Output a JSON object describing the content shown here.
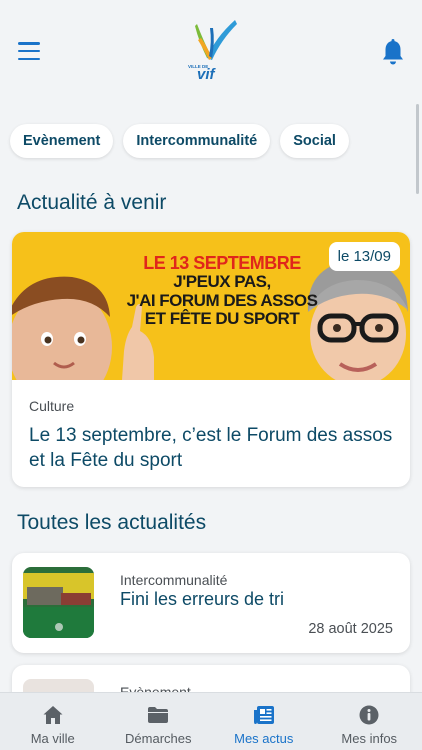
{
  "header": {
    "logo_line1": "VILLE DE",
    "logo_line2": "vif",
    "menu_icon": "hamburger-menu-icon",
    "bell_icon": "bell-icon"
  },
  "categories": [
    {
      "label": "Evènement"
    },
    {
      "label": "Intercommunalité"
    },
    {
      "label": "Social"
    }
  ],
  "upcoming": {
    "section_title": "Actualité à venir",
    "card": {
      "banner_lines": [
        "LE 13 SEPTEMBRE",
        "J'PEUX PAS,",
        "J'AI FORUM DES ASSOS",
        "ET FÊTE DU SPORT"
      ],
      "date_badge": "le 13/09",
      "category": "Culture",
      "title": "Le 13 septembre, c’est le Forum des assos et la Fête du sport"
    }
  },
  "all_news": {
    "section_title": "Toutes les actualités",
    "items": [
      {
        "category": "Intercommunalité",
        "title": "Fini les erreurs de tri",
        "date": "28 août 2025"
      },
      {
        "category": "Evènement",
        "title": "",
        "date": ""
      }
    ]
  },
  "tabbar": {
    "tabs": [
      {
        "label": "Ma ville",
        "icon": "home-icon",
        "active": false
      },
      {
        "label": "Démarches",
        "icon": "folder-icon",
        "active": false
      },
      {
        "label": "Mes actus",
        "icon": "newspaper-icon",
        "active": true
      },
      {
        "label": "Mes infos",
        "icon": "info-icon",
        "active": false
      }
    ]
  },
  "colors": {
    "primary": "#0d4a66",
    "accent_blue": "#1a73c9",
    "banner_yellow": "#f6c11a",
    "banner_red": "#e0261b"
  }
}
